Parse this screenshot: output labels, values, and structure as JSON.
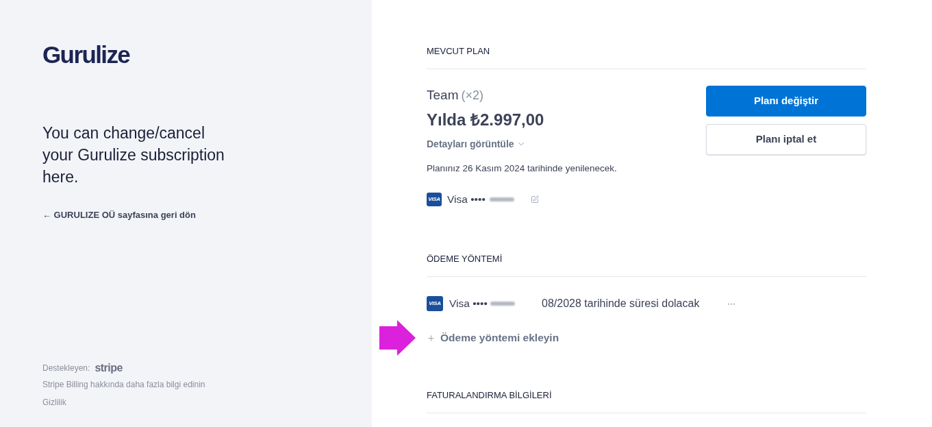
{
  "sidebar": {
    "logo": "Gurulize",
    "headline": "You can change/cancel your Gurulize subscription here.",
    "back_link": "← GURULIZE OÜ sayfasına geri dön",
    "powered_by": {
      "label": "Destekleyen:",
      "brand": "stripe"
    },
    "links": [
      "Stripe Billing hakkında daha fazla bilgi edinin",
      "Gizlilik"
    ]
  },
  "current_plan": {
    "heading": "MEVCUT PLAN",
    "name": "Team",
    "quantity": "(×2)",
    "price": "Yılda ₺2.997,00",
    "details_link": "Detayları görüntüle",
    "renewal_note": "Planınız 26 Kasım 2024 tarihinde yenilenecek.",
    "card": {
      "badge": "VISA",
      "brand": "Visa",
      "masked": "••••"
    },
    "buttons": [
      {
        "label": "Planı değiştir",
        "kind": "primary"
      },
      {
        "label": "Planı iptal et",
        "kind": "secondary"
      }
    ]
  },
  "payment_method": {
    "heading": "ÖDEME YÖNTEMİ",
    "cards": [
      {
        "badge": "VISA",
        "brand": "Visa",
        "masked": "••••",
        "expiry": "08/2028 tarihinde süresi dolacak",
        "menu": "···"
      }
    ],
    "add_link": "Ödeme yöntemi ekleyin"
  },
  "billing_info": {
    "heading": "FATURALANDIRMA BİLGİLERİ"
  }
}
